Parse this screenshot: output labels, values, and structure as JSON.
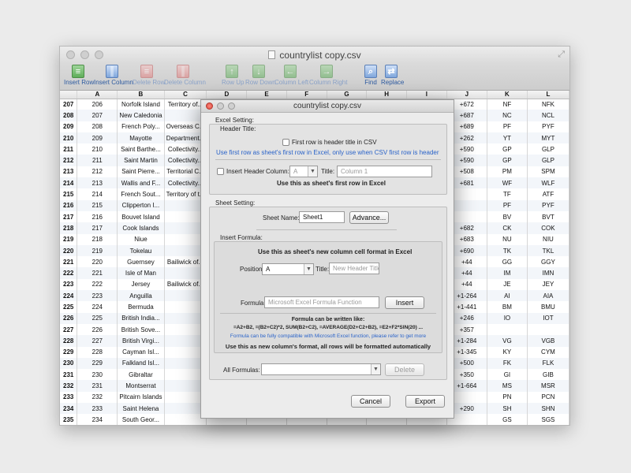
{
  "window": {
    "title": "countrylist copy.csv"
  },
  "toolbar": [
    {
      "label": "Insert Row",
      "icon": "insert-row-icon"
    },
    {
      "label": "Insert Column",
      "icon": "insert-column-icon"
    },
    {
      "label": "Delete Row",
      "icon": "delete-row-icon"
    },
    {
      "label": "Delete Column",
      "icon": "delete-column-icon"
    },
    {
      "label": "Row Up",
      "icon": "row-up-icon"
    },
    {
      "label": "Row Down",
      "icon": "row-down-icon"
    },
    {
      "label": "Column Left",
      "icon": "column-left-icon"
    },
    {
      "label": "Column Right",
      "icon": "column-right-icon"
    },
    {
      "label": "Find",
      "icon": "find-icon"
    },
    {
      "label": "Replace",
      "icon": "replace-icon"
    }
  ],
  "grid": {
    "columns": [
      "",
      "A",
      "B",
      "C",
      "D",
      "E",
      "F",
      "G",
      "H",
      "I",
      "J",
      "K",
      "L"
    ],
    "rows": [
      [
        "207",
        "206",
        "Norfolk Island",
        "Territory of...",
        "",
        "",
        "",
        "",
        "",
        "",
        "+672",
        "NF",
        "NFK"
      ],
      [
        "208",
        "207",
        "New Caledonia",
        "",
        "",
        "",
        "",
        "",
        "",
        "",
        "+687",
        "NC",
        "NCL"
      ],
      [
        "209",
        "208",
        "French Poly...",
        "Overseas C...",
        "",
        "",
        "",
        "",
        "",
        "",
        "+689",
        "PF",
        "PYF"
      ],
      [
        "210",
        "209",
        "Mayotte",
        "Department...",
        "",
        "",
        "",
        "",
        "",
        "",
        "+262",
        "YT",
        "MYT"
      ],
      [
        "211",
        "210",
        "Saint Barthe...",
        "Collectivity...",
        "",
        "",
        "",
        "",
        "",
        "",
        "+590",
        "GP",
        "GLP"
      ],
      [
        "212",
        "211",
        "Saint Martin",
        "Collectivity...",
        "",
        "",
        "",
        "",
        "",
        "",
        "+590",
        "GP",
        "GLP"
      ],
      [
        "213",
        "212",
        "Saint Pierre...",
        "Territorial C...",
        "",
        "",
        "",
        "",
        "",
        "",
        "+508",
        "PM",
        "SPM"
      ],
      [
        "214",
        "213",
        "Wallis and F...",
        "Collectivity...",
        "",
        "",
        "",
        "",
        "",
        "",
        "+681",
        "WF",
        "WLF"
      ],
      [
        "215",
        "214",
        "French Sout...",
        "Territory of t...",
        "",
        "",
        "",
        "",
        "",
        "",
        "",
        "TF",
        "ATF"
      ],
      [
        "216",
        "215",
        "Clipperton I...",
        "",
        "",
        "",
        "",
        "",
        "",
        "",
        "",
        "PF",
        "PYF"
      ],
      [
        "217",
        "216",
        "Bouvet Island",
        "",
        "",
        "",
        "",
        "",
        "",
        "",
        "",
        "BV",
        "BVT"
      ],
      [
        "218",
        "217",
        "Cook Islands",
        "",
        "",
        "",
        "",
        "",
        "",
        "",
        "+682",
        "CK",
        "COK"
      ],
      [
        "219",
        "218",
        "Niue",
        "",
        "",
        "",
        "",
        "",
        "",
        "",
        "+683",
        "NU",
        "NIU"
      ],
      [
        "220",
        "219",
        "Tokelau",
        "",
        "",
        "",
        "",
        "",
        "",
        "",
        "+690",
        "TK",
        "TKL"
      ],
      [
        "221",
        "220",
        "Guernsey",
        "Bailiwick of...",
        "",
        "",
        "",
        "",
        "",
        "",
        "+44",
        "GG",
        "GGY"
      ],
      [
        "222",
        "221",
        "Isle of Man",
        "",
        "",
        "",
        "",
        "",
        "",
        "",
        "+44",
        "IM",
        "IMN"
      ],
      [
        "223",
        "222",
        "Jersey",
        "Bailiwick of...",
        "",
        "",
        "",
        "",
        "",
        "",
        "+44",
        "JE",
        "JEY"
      ],
      [
        "224",
        "223",
        "Anguilla",
        "",
        "",
        "",
        "",
        "",
        "",
        "",
        "+1-264",
        "AI",
        "AIA"
      ],
      [
        "225",
        "224",
        "Bermuda",
        "",
        "",
        "",
        "",
        "",
        "",
        "",
        "+1-441",
        "BM",
        "BMU"
      ],
      [
        "226",
        "225",
        "British India...",
        "",
        "",
        "",
        "",
        "",
        "",
        "",
        "+246",
        "IO",
        "IOT"
      ],
      [
        "227",
        "226",
        "British Sove...",
        "",
        "",
        "",
        "",
        "",
        "",
        "",
        "+357",
        "",
        ""
      ],
      [
        "228",
        "227",
        "British Virgi...",
        "",
        "",
        "",
        "",
        "",
        "",
        "",
        "+1-284",
        "VG",
        "VGB"
      ],
      [
        "229",
        "228",
        "Cayman Isl...",
        "",
        "",
        "",
        "",
        "",
        "",
        "",
        "+1-345",
        "KY",
        "CYM"
      ],
      [
        "230",
        "229",
        "Falkland Isl...",
        "",
        "",
        "",
        "",
        "",
        "",
        "",
        "+500",
        "FK",
        "FLK"
      ],
      [
        "231",
        "230",
        "Gibraltar",
        "",
        "",
        "",
        "",
        "",
        "",
        "",
        "+350",
        "GI",
        "GIB"
      ],
      [
        "232",
        "231",
        "Montserrat",
        "",
        "",
        "",
        "",
        "",
        "",
        "",
        "+1-664",
        "MS",
        "MSR"
      ],
      [
        "233",
        "232",
        "Pitcairn Islands",
        "",
        "",
        "",
        "",
        "",
        "",
        "",
        "",
        "PN",
        "PCN"
      ],
      [
        "234",
        "233",
        "Saint Helena",
        "",
        "",
        "",
        "",
        "",
        "",
        "",
        "+290",
        "SH",
        "SHN"
      ],
      [
        "235",
        "234",
        "South Geor...",
        "",
        "",
        "",
        "",
        "",
        "",
        "",
        "",
        "GS",
        "SGS"
      ]
    ]
  },
  "dialog": {
    "title": "countrylist copy.csv",
    "excel_setting": "Excel Setting:",
    "header_title": "Header Title:",
    "first_row_header": "First row is header title in CSV",
    "first_row_hint": "Use first row as sheet's first row in Excel, only use when CSV first row is header",
    "insert_header": "Insert Header",
    "column_label": "Column:",
    "column_value": "A",
    "title_label": "Title:",
    "title_placeholder": "Column 1",
    "use_first_row": "Use this as sheet's first row in Excel",
    "sheet_setting": "Sheet Setting:",
    "sheet_name_label": "Sheet Name:",
    "sheet_name_value": "Sheet1",
    "advance_button": "Advance...",
    "insert_formula": "Insert Formula:",
    "formula_hint": "Use this as sheet's new column cell format in Excel",
    "position_label": "Position:",
    "position_value": "A",
    "new_title_placeholder": "New Header Title",
    "formula_label": "Formula:",
    "formula_placeholder": "Microsoft Excel Formula Function",
    "insert_button": "Insert",
    "formula_like": "Formula can be written like:",
    "formula_examples": "=A2+B2, =(B2+C2)*2, SUM(B2+C2), =AVERAGE(D2+C2+B2), =E2+F2*SIN(20) ...",
    "formula_compat": "Formula can be fully compatible with Microsoft Excel function, please refer to get more",
    "formula_auto": "Use this as new column's format, all rows will be formatted automatically",
    "all_formulas_label": "All Formulas:",
    "delete_button": "Delete",
    "cancel_button": "Cancel",
    "export_button": "Export"
  }
}
